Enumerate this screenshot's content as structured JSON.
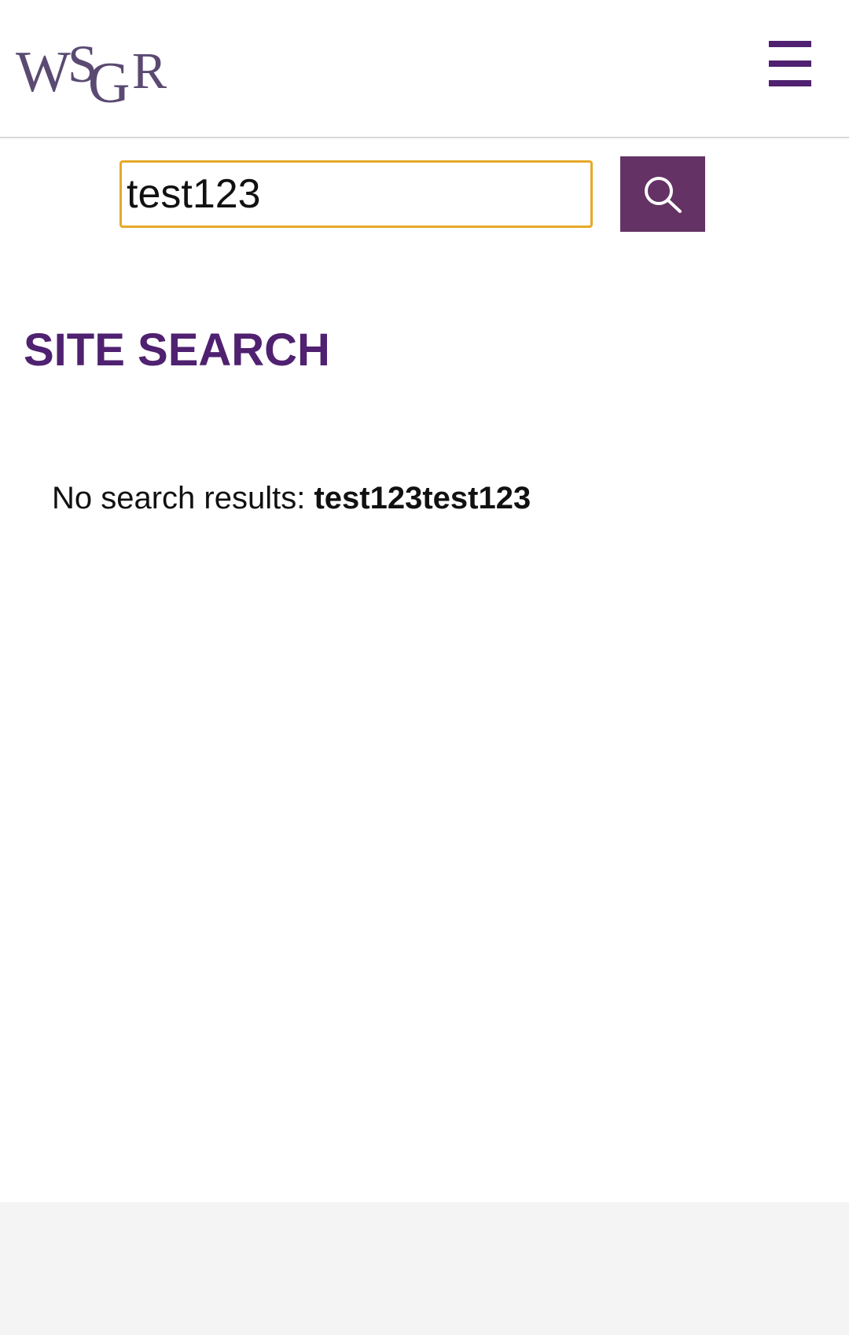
{
  "header": {
    "logo_text": "WSGR",
    "menu_icon": "hamburger-menu-icon"
  },
  "search": {
    "value": "test123",
    "button_icon": "search-icon"
  },
  "main": {
    "title": "SITE SEARCH",
    "results_prefix": "No search results:",
    "results_query": "test123test123"
  },
  "colors": {
    "brand_purple": "#4f2170",
    "button_purple": "#643264",
    "input_focus_border": "#e6a92a",
    "footer_bg": "#f4f4f4"
  }
}
